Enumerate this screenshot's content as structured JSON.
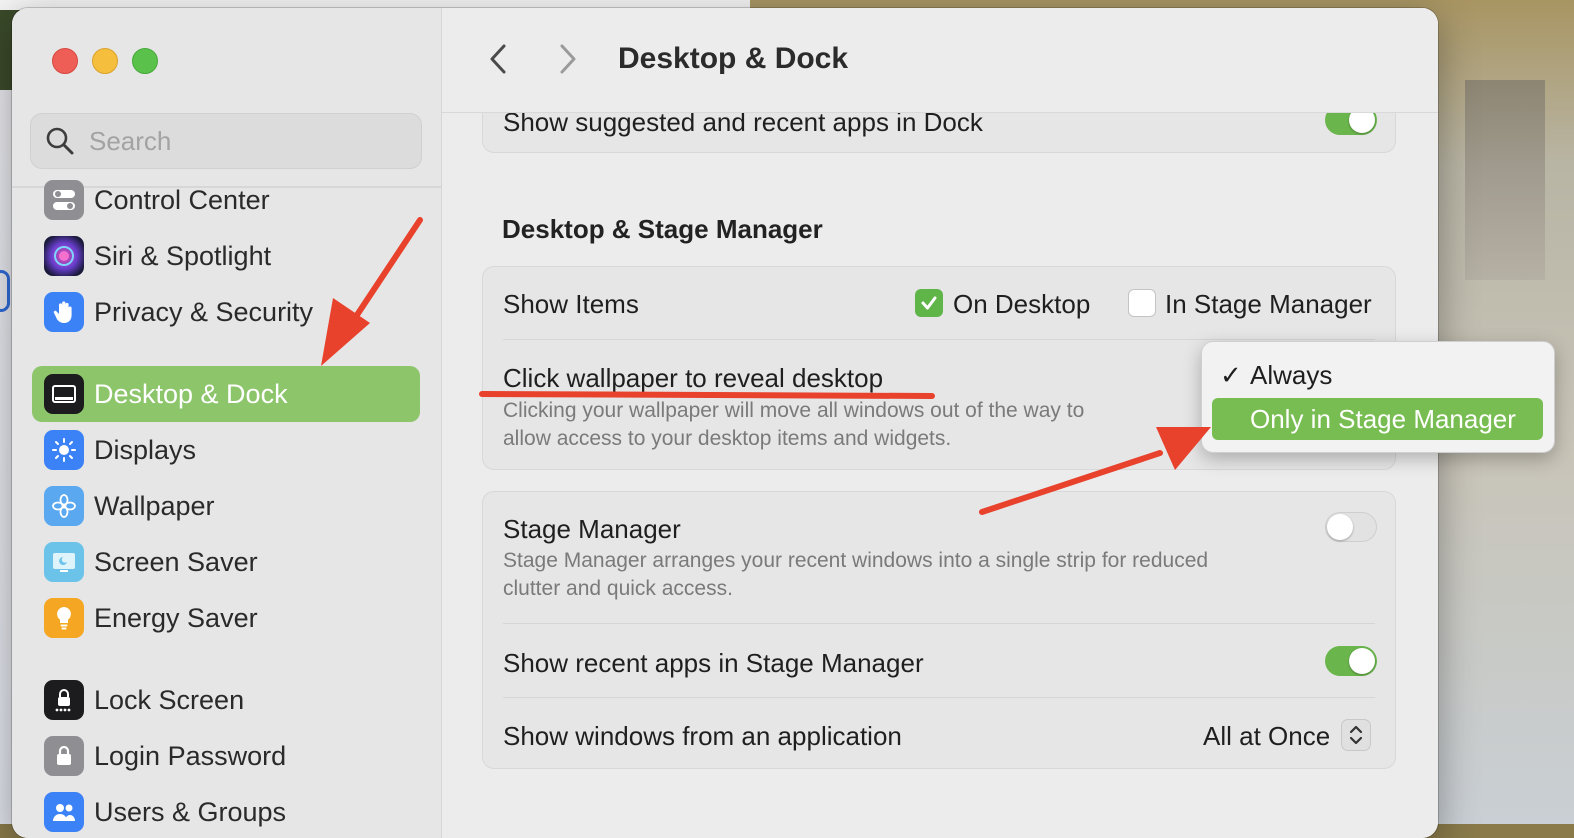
{
  "window": {
    "title": "Desktop & Dock"
  },
  "search": {
    "placeholder": "Search"
  },
  "sidebar": {
    "items": [
      {
        "label": "Control Center",
        "icon": "control-center-icon",
        "color": "#8e8e93"
      },
      {
        "label": "Siri & Spotlight",
        "icon": "siri-icon",
        "color": "#6a3fcf"
      },
      {
        "label": "Privacy & Security",
        "icon": "hand-icon",
        "color": "#3b82f6"
      },
      {
        "label": "Desktop & Dock",
        "icon": "dock-icon",
        "color": "#1c1c1e",
        "selected": true
      },
      {
        "label": "Displays",
        "icon": "sun-icon",
        "color": "#3b82f6"
      },
      {
        "label": "Wallpaper",
        "icon": "flower-icon",
        "color": "#5aa9f0"
      },
      {
        "label": "Screen Saver",
        "icon": "screen-saver-icon",
        "color": "#6cc3ea"
      },
      {
        "label": "Energy Saver",
        "icon": "bulb-icon",
        "color": "#f5a623"
      },
      {
        "label": "Lock Screen",
        "icon": "lock-screen-icon",
        "color": "#1c1c1e"
      },
      {
        "label": "Login Password",
        "icon": "lock-icon",
        "color": "#8e8e93"
      },
      {
        "label": "Users & Groups",
        "icon": "users-icon",
        "color": "#3b82f6"
      }
    ]
  },
  "main": {
    "top_row": {
      "label": "Show suggested and recent apps in Dock",
      "toggle": "on"
    },
    "section_title": "Desktop & Stage Manager",
    "show_items": {
      "label": "Show Items",
      "on_desktop": {
        "label": "On Desktop",
        "checked": true
      },
      "in_stage_manager": {
        "label": "In Stage Manager",
        "checked": false
      }
    },
    "click_wallpaper": {
      "label": "Click wallpaper to reveal desktop",
      "description_line1": "Clicking your wallpaper will move all windows out of the way to",
      "description_line2": "allow access to your desktop items and widgets."
    },
    "stage_manager": {
      "label": "Stage Manager",
      "toggle": "off",
      "description_line1": "Stage Manager arranges your recent windows into a single strip for reduced",
      "description_line2": "clutter and quick access."
    },
    "recent_apps": {
      "label": "Show recent apps in Stage Manager",
      "toggle": "on"
    },
    "show_windows": {
      "label": "Show windows from an application",
      "value": "All at Once"
    }
  },
  "popup_menu": {
    "items": [
      {
        "label": "Always",
        "checked": true,
        "highlighted": false
      },
      {
        "label": "Only in Stage Manager",
        "checked": false,
        "highlighted": true
      }
    ]
  },
  "colors": {
    "accent": "#8dc56b",
    "annotation": "#e8412c"
  }
}
